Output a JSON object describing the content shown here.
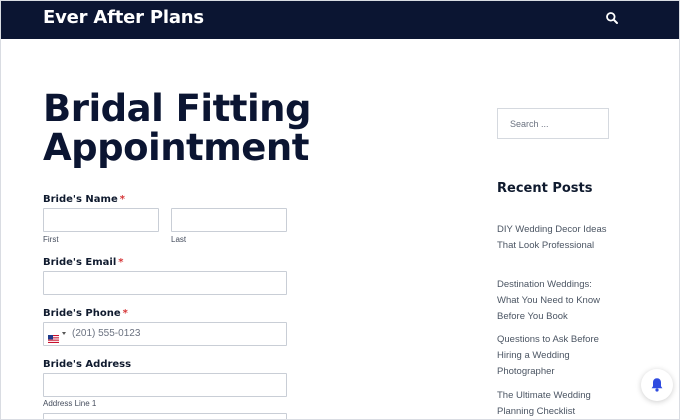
{
  "header": {
    "site_title": "Ever After Plans",
    "search_icon": "search-icon"
  },
  "main": {
    "page_title": "Bridal Fitting Appointment",
    "form": {
      "brides_name": {
        "label": "Bride's Name",
        "required_mark": "*",
        "first_sublabel": "First",
        "last_sublabel": "Last",
        "first_value": "",
        "last_value": ""
      },
      "brides_email": {
        "label": "Bride's Email",
        "required_mark": "*",
        "value": ""
      },
      "brides_phone": {
        "label": "Bride's Phone",
        "required_mark": "*",
        "placeholder": "(201) 555-0123",
        "country_flag": "us-flag-icon"
      },
      "brides_address": {
        "label": "Bride's Address",
        "line1_sublabel": "Address Line 1",
        "line1_value": ""
      }
    }
  },
  "sidebar": {
    "search_placeholder": "Search ...",
    "recent_posts_title": "Recent Posts",
    "posts": [
      {
        "title": "DIY Wedding Decor Ideas That Look Professional"
      },
      {
        "title": "Destination Weddings: What You Need to Know Before You Book"
      },
      {
        "title": "Questions to Ask Before Hiring a Wedding Photographer"
      },
      {
        "title": "The Ultimate Wedding Planning Checklist"
      }
    ]
  },
  "floating": {
    "icon": "bell-icon"
  },
  "colors": {
    "header_bg": "#0b1532",
    "required": "#d63638",
    "accent": "#2f4be0"
  }
}
